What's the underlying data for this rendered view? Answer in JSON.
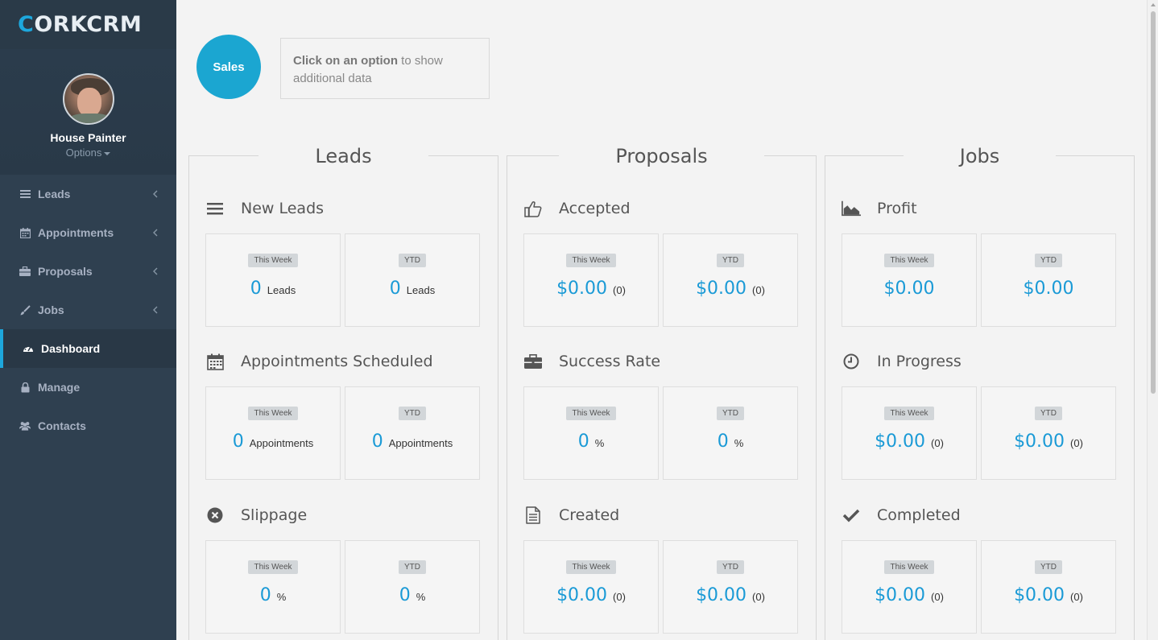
{
  "app": {
    "logo_c": "C",
    "logo_rest": "ORKCRM"
  },
  "profile": {
    "name": "House Painter",
    "options": "Options"
  },
  "nav": [
    {
      "label": "Leads",
      "icon": "list-icon",
      "expandable": true
    },
    {
      "label": "Appointments",
      "icon": "calendar-icon",
      "expandable": true
    },
    {
      "label": "Proposals",
      "icon": "briefcase-icon",
      "expandable": true
    },
    {
      "label": "Jobs",
      "icon": "brush-icon",
      "expandable": true
    },
    {
      "label": "Dashboard",
      "icon": "dashboard-icon",
      "expandable": false,
      "active": true
    },
    {
      "label": "Manage",
      "icon": "lock-icon",
      "expandable": false
    },
    {
      "label": "Contacts",
      "icon": "users-icon",
      "expandable": false
    }
  ],
  "sales_button": "Sales",
  "hint": {
    "bold": "Click on an option",
    "rest": " to show additional data"
  },
  "columns": {
    "leads": {
      "title": "Leads",
      "sections": [
        {
          "title": "New Leads",
          "icon": "bars-icon",
          "cards": [
            {
              "badge": "This Week",
              "value": "0",
              "unit": "Leads"
            },
            {
              "badge": "YTD",
              "value": "0",
              "unit": "Leads"
            }
          ]
        },
        {
          "title": "Appointments Scheduled",
          "icon": "calendar-icon",
          "cards": [
            {
              "badge": "This Week",
              "value": "0",
              "unit": "Appointments"
            },
            {
              "badge": "YTD",
              "value": "0",
              "unit": "Appointments"
            }
          ]
        },
        {
          "title": "Slippage",
          "icon": "x-circle-icon",
          "cards": [
            {
              "badge": "This Week",
              "value": "0",
              "unit": "%"
            },
            {
              "badge": "YTD",
              "value": "0",
              "unit": "%"
            }
          ]
        }
      ]
    },
    "proposals": {
      "title": "Proposals",
      "sections": [
        {
          "title": "Accepted",
          "icon": "thumbs-up-icon",
          "cards": [
            {
              "badge": "This Week",
              "value": "$0.00",
              "unit": "(0)"
            },
            {
              "badge": "YTD",
              "value": "$0.00",
              "unit": "(0)"
            }
          ]
        },
        {
          "title": "Success Rate",
          "icon": "briefcase-icon",
          "cards": [
            {
              "badge": "This Week",
              "value": "0",
              "unit": "%"
            },
            {
              "badge": "YTD",
              "value": "0",
              "unit": "%"
            }
          ]
        },
        {
          "title": "Created",
          "icon": "document-icon",
          "cards": [
            {
              "badge": "This Week",
              "value": "$0.00",
              "unit": "(0)"
            },
            {
              "badge": "YTD",
              "value": "$0.00",
              "unit": "(0)"
            }
          ]
        }
      ]
    },
    "jobs": {
      "title": "Jobs",
      "sections": [
        {
          "title": "Profit",
          "icon": "area-chart-icon",
          "cards": [
            {
              "badge": "This Week",
              "value": "$0.00",
              "unit": ""
            },
            {
              "badge": "YTD",
              "value": "$0.00",
              "unit": ""
            }
          ]
        },
        {
          "title": "In Progress",
          "icon": "clock-icon",
          "cards": [
            {
              "badge": "This Week",
              "value": "$0.00",
              "unit": "(0)"
            },
            {
              "badge": "YTD",
              "value": "$0.00",
              "unit": "(0)"
            }
          ]
        },
        {
          "title": "Completed",
          "icon": "check-icon",
          "cards": [
            {
              "badge": "This Week",
              "value": "$0.00",
              "unit": "(0)"
            },
            {
              "badge": "YTD",
              "value": "$0.00",
              "unit": "(0)"
            }
          ]
        }
      ]
    }
  },
  "colors": {
    "accent": "#1da7dc",
    "sidebar": "#2f4050",
    "value": "#1a9ad6"
  }
}
